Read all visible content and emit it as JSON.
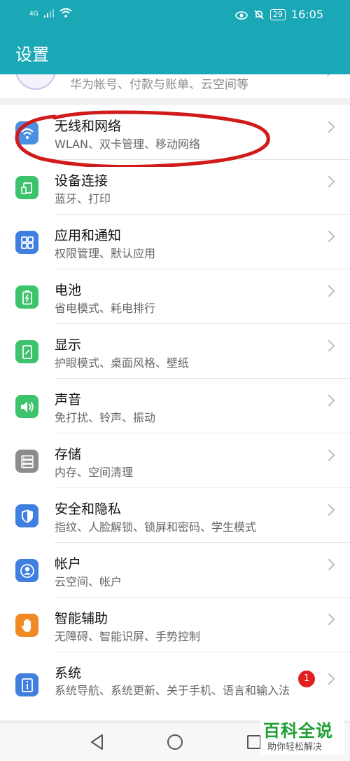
{
  "status_bar": {
    "network": "4G",
    "battery": "29",
    "time": "16:05"
  },
  "header": {
    "title": "设置"
  },
  "account": {
    "subtitle": "华为帐号、付款与账单、云空间等"
  },
  "rows": [
    {
      "id": "wireless",
      "title": "无线和网络",
      "subtitle": "WLAN、双卡管理、移动网络",
      "icon": "wifi-icon",
      "color": "#4a90e2"
    },
    {
      "id": "device-connection",
      "title": "设备连接",
      "subtitle": "蓝牙、打印",
      "icon": "device-connection-icon",
      "color": "#3cc36c"
    },
    {
      "id": "apps-notifications",
      "title": "应用和通知",
      "subtitle": "权限管理、默认应用",
      "icon": "apps-grid-icon",
      "color": "#3f7fe0"
    },
    {
      "id": "battery",
      "title": "电池",
      "subtitle": "省电模式、耗电排行",
      "icon": "battery-icon",
      "color": "#3cc36c"
    },
    {
      "id": "display",
      "title": "显示",
      "subtitle": "护眼模式、桌面风格、壁纸",
      "icon": "display-icon",
      "color": "#3cc36c"
    },
    {
      "id": "sound",
      "title": "声音",
      "subtitle": "免打扰、铃声、振动",
      "icon": "speaker-icon",
      "color": "#3cc36c"
    },
    {
      "id": "storage",
      "title": "存储",
      "subtitle": "内存、空间清理",
      "icon": "storage-icon",
      "color": "#8c8c8c"
    },
    {
      "id": "security-privacy",
      "title": "安全和隐私",
      "subtitle": "指纹、人脸解锁、锁屏和密码、学生模式",
      "icon": "shield-icon",
      "color": "#3f7fe0"
    },
    {
      "id": "accounts",
      "title": "帐户",
      "subtitle": "云空间、帐户",
      "icon": "account-icon",
      "color": "#3f7fe0"
    },
    {
      "id": "accessibility",
      "title": "智能辅助",
      "subtitle": "无障碍、智能识屏、手势控制",
      "icon": "hand-icon",
      "color": "#f08a24"
    },
    {
      "id": "system",
      "title": "系统",
      "subtitle": "系统导航、系统更新、关于手机、语言和输入法",
      "icon": "info-icon",
      "color": "#3f7fe0",
      "badge": "1"
    }
  ],
  "watermark": {
    "main": "百科全说",
    "sub": "助你轻松解决"
  },
  "colors": {
    "header": "#1aa7b6",
    "annotation": "#d11a1a",
    "badge": "#e02020"
  }
}
